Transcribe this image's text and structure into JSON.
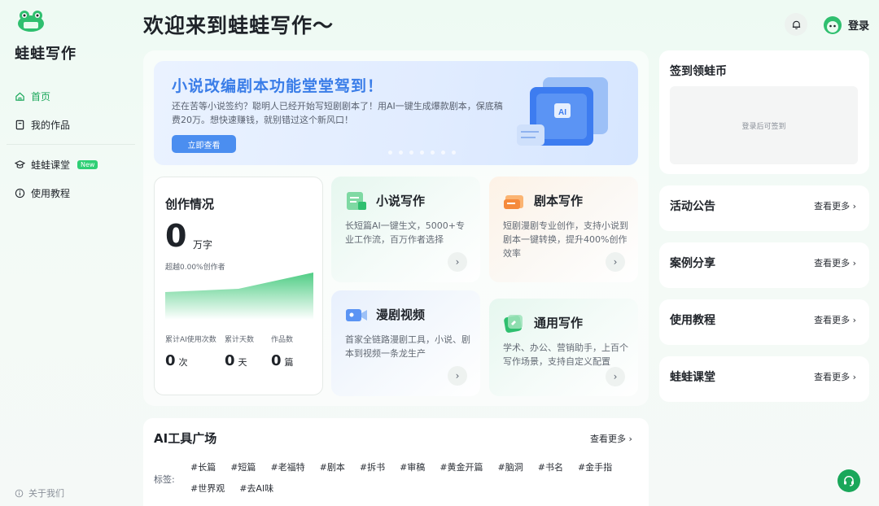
{
  "app": {
    "brand": "蛙蛙写作",
    "logo_icon": "frog-logo-icon"
  },
  "sidebar": {
    "items": [
      {
        "label": "首页",
        "icon": "home-icon"
      },
      {
        "label": "我的作品",
        "icon": "book-icon"
      },
      {
        "label": "蛙蛙课堂",
        "icon": "graduation-cap-icon",
        "badge": "New"
      },
      {
        "label": "使用教程",
        "icon": "info-circle-icon"
      }
    ],
    "about": "关于我们"
  },
  "header": {
    "title": "欢迎来到蛙蛙写作～",
    "login": "登录"
  },
  "banner": {
    "title": "小说改编剧本功能堂堂驾到！",
    "desc": "还在苦等小说签约？聪明人已经开始写短剧剧本了！用AI一键生成爆款剧本，保底稿费20万。想快速赚钱，就别错过这个新风口！",
    "button": "立即查看",
    "art_label": "AI"
  },
  "stats": {
    "title": "创作情况",
    "words": "0",
    "words_unit": "万字",
    "exceed": "超越0.00%创作者",
    "items": [
      {
        "label": "累计AI使用次数",
        "value": "0",
        "unit": "次"
      },
      {
        "label": "累计天数",
        "value": "0",
        "unit": "天"
      },
      {
        "label": "作品数",
        "value": "0",
        "unit": "篇"
      }
    ]
  },
  "tools": [
    {
      "title": "小说写作",
      "desc": "长短篇AI一键生文，5000+专业工作流，百万作者选择"
    },
    {
      "title": "剧本写作",
      "desc": "短剧漫剧专业创作，支持小说到剧本一键转换，提升400%创作效率"
    },
    {
      "title": "漫剧视频",
      "desc": "首家全链路漫剧工具，小说、剧本到视频一条龙生产"
    },
    {
      "title": "通用写作",
      "desc": "学术、办公、营销助手，上百个写作场景，支持自定义配置"
    }
  ],
  "ai_tools": {
    "title": "AI工具广场",
    "more": "查看更多",
    "tags_label": "标签:",
    "tags": [
      "#长篇",
      "#短篇",
      "#老福特",
      "#剧本",
      "#拆书",
      "#审稿",
      "#黄金开篇",
      "#脑洞",
      "#书名",
      "#金手指",
      "#世界观",
      "#去AI味"
    ]
  },
  "right": {
    "checkin": {
      "title": "签到领蛙币",
      "hint": "登录后可签到"
    },
    "sections": [
      {
        "title": "活动公告",
        "more": "查看更多"
      },
      {
        "title": "案例分享",
        "more": "查看更多"
      },
      {
        "title": "使用教程",
        "more": "查看更多"
      },
      {
        "title": "蛙蛙课堂",
        "more": "查看更多"
      }
    ]
  },
  "colors": {
    "accent": "#1aa75a",
    "banner_title": "#3a7de8",
    "banner_button": "#4b8ef0"
  }
}
